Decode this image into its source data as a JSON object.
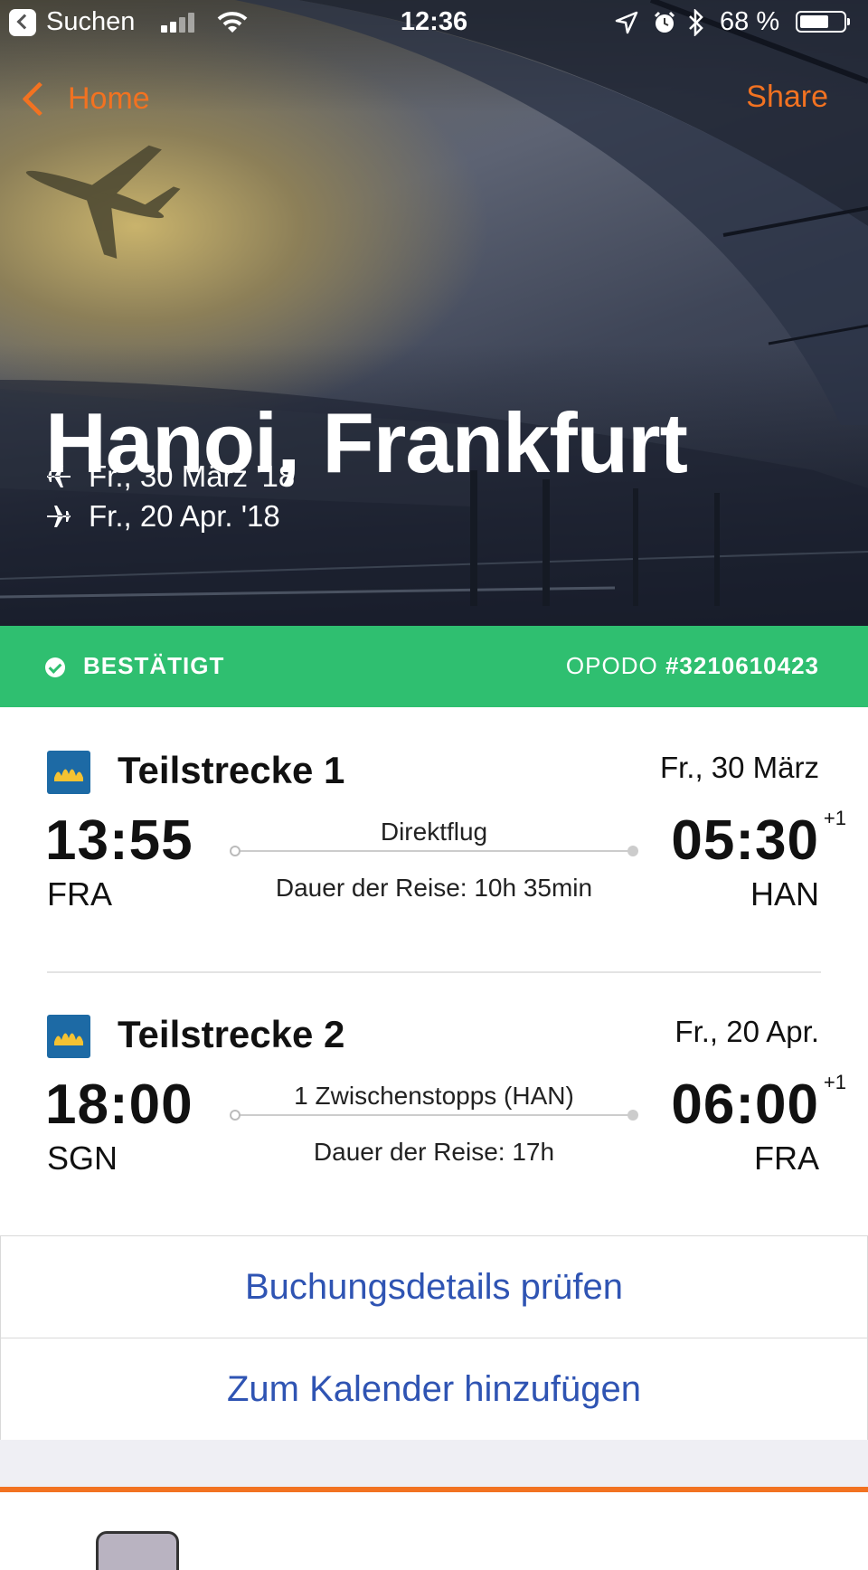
{
  "status_bar": {
    "carrier": "Suchen",
    "time": "12:36",
    "battery": "68 %",
    "battery_level": 0.68
  },
  "nav": {
    "back_label": "Home",
    "share_label": "Share"
  },
  "hero": {
    "title": "Hanoi, Frankfurt",
    "outbound_date": "Fr., 30 März '18",
    "return_date": "Fr., 20 Apr. '18"
  },
  "booking": {
    "status": "BESTÄTIGT",
    "ref_prefix": "OPODO ",
    "ref_number": "#3210610423"
  },
  "legs": [
    {
      "title": "Teilstrecke 1",
      "date": "Fr., 30 März",
      "dep_time": "13:55",
      "dep_code": "FRA",
      "arr_time": "05:30",
      "arr_offset": "+1",
      "arr_code": "HAN",
      "stops": "Direktflug",
      "duration": "Dauer der Reise: 10h 35min"
    },
    {
      "title": "Teilstrecke 2",
      "date": "Fr., 20 Apr.",
      "dep_time": "18:00",
      "dep_code": "SGN",
      "arr_time": "06:00",
      "arr_offset": "+1",
      "arr_code": "FRA",
      "stops": "1 Zwischenstopps (HAN)",
      "duration": "Dauer der Reise: 17h"
    }
  ],
  "actions": {
    "details": "Buchungsdetails prüfen",
    "calendar": "Zum Kalender hinzufügen"
  },
  "colors": {
    "accent": "#f27221",
    "confirmed": "#2fbf70",
    "link": "#2f54b3"
  }
}
